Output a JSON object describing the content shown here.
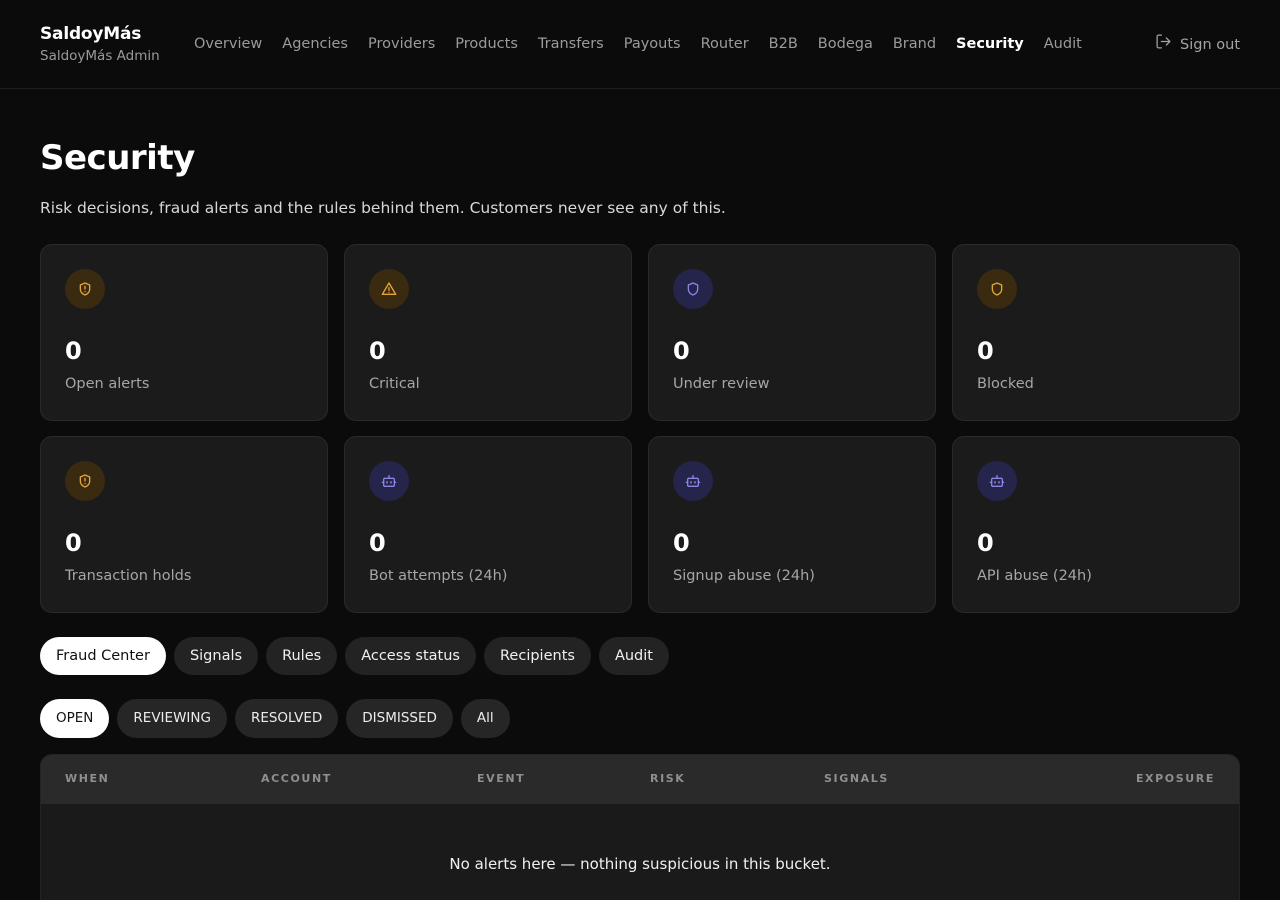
{
  "brand": {
    "name": "SaldoyMás",
    "subtitle": "SaldoyMás Admin"
  },
  "nav": {
    "items": [
      {
        "label": "Overview"
      },
      {
        "label": "Agencies"
      },
      {
        "label": "Providers"
      },
      {
        "label": "Products"
      },
      {
        "label": "Transfers"
      },
      {
        "label": "Payouts"
      },
      {
        "label": "Router"
      },
      {
        "label": "B2B"
      },
      {
        "label": "Bodega"
      },
      {
        "label": "Brand"
      },
      {
        "label": "Security"
      },
      {
        "label": "Audit"
      }
    ],
    "active": "Security",
    "sign_out": "Sign out"
  },
  "page": {
    "title": "Security",
    "description": "Risk decisions, fraud alerts and the rules behind them. Customers never see any of this."
  },
  "stats": [
    {
      "value": "0",
      "label": "Open alerts",
      "icon": "shield-alert-icon",
      "tone": "amber"
    },
    {
      "value": "0",
      "label": "Critical",
      "icon": "warning-triangle-icon",
      "tone": "amber"
    },
    {
      "value": "0",
      "label": "Under review",
      "icon": "shield-icon",
      "tone": "indigo"
    },
    {
      "value": "0",
      "label": "Blocked",
      "icon": "shield-icon",
      "tone": "amber"
    },
    {
      "value": "0",
      "label": "Transaction holds",
      "icon": "shield-alert-icon",
      "tone": "amber"
    },
    {
      "value": "0",
      "label": "Bot attempts (24h)",
      "icon": "bot-icon",
      "tone": "indigo"
    },
    {
      "value": "0",
      "label": "Signup abuse (24h)",
      "icon": "bot-icon",
      "tone": "indigo"
    },
    {
      "value": "0",
      "label": "API abuse (24h)",
      "icon": "bot-icon",
      "tone": "indigo"
    }
  ],
  "tabs": [
    {
      "label": "Fraud Center",
      "active": true
    },
    {
      "label": "Signals"
    },
    {
      "label": "Rules"
    },
    {
      "label": "Access status"
    },
    {
      "label": "Recipients"
    },
    {
      "label": "Audit"
    }
  ],
  "filters": [
    {
      "label": "OPEN",
      "active": true
    },
    {
      "label": "REVIEWING"
    },
    {
      "label": "RESOLVED"
    },
    {
      "label": "DISMISSED"
    },
    {
      "label": "All"
    }
  ],
  "table": {
    "columns": [
      "WHEN",
      "ACCOUNT",
      "EVENT",
      "RISK",
      "SIGNALS",
      "EXPOSURE"
    ],
    "empty_message": "No alerts here — nothing suspicious in this bucket."
  },
  "colors": {
    "amber": "#e3a53a",
    "indigo": "#8a86e6",
    "background": "#0b0b0b",
    "card": "#1b1b1b"
  }
}
